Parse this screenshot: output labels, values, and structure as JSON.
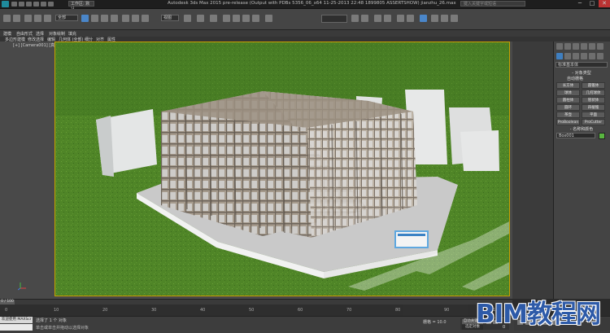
{
  "title_bar": {
    "title": "Autodesk 3ds Max 2015 pre-release (Output with PDBs 5356_06_x64 11-25-2013 22:48 1899805 ASSERTSHOW)  jianzhu_26.max",
    "workspace": "工作区: 默认",
    "search_placeholder": "键入关键字或短语",
    "win_min": "─",
    "win_max": "□",
    "win_close": "✕"
  },
  "toolbar": {
    "selection_filter": "全部",
    "view_dropdown": "视图"
  },
  "ribbon": {
    "tabs": [
      "建模",
      "自由形式",
      "选择",
      "对象绘制",
      "填充"
    ],
    "sub_tabs": [
      "多边形建模",
      "修改选择",
      "编辑",
      "几何体 (全部)",
      "细分",
      "对齐",
      "属性"
    ]
  },
  "viewport": {
    "label": "[+] [Camera001] [真实]"
  },
  "command_panel": {
    "category": "标准基本体",
    "object_type_title": "- 对象类型",
    "autogrid": "自动栅格",
    "object_buttons": [
      "长方体",
      "圆锥体",
      "球体",
      "几何球体",
      "圆柱体",
      "管状体",
      "圆环",
      "四棱锥",
      "茶壶",
      "平面",
      "ProBoolean",
      "ProCutter"
    ],
    "name_color_title": "- 名称和颜色",
    "name_value": "Box001",
    "swatch_color": "#59b640"
  },
  "timeline": {
    "slider_label": "0 / 100",
    "ticks": [
      "0",
      "10",
      "20",
      "30",
      "40",
      "50",
      "60",
      "70",
      "80",
      "90",
      "100"
    ]
  },
  "status_bar": {
    "maxscript_a": "欢迎使用 MAXScr",
    "maxscript_b": "",
    "line1": "选择了 1 个 对象",
    "line2": "单击或单击并拖动以选择对象",
    "grid": "栅格 = 10.0",
    "autokey": "自动关键点",
    "selected": "选定对象",
    "frame": "0"
  },
  "watermark": {
    "latin": "BIM",
    "cjk": "教程网"
  }
}
